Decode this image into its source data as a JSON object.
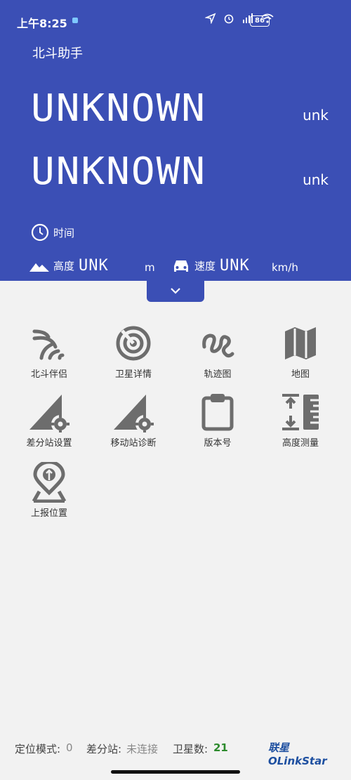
{
  "status": {
    "time": "上午8:25",
    "battery": "86"
  },
  "app_title": "北斗助手",
  "lat": {
    "value": "UNKNOWN",
    "unit": "unk"
  },
  "lon": {
    "value": "UNKNOWN",
    "unit": "unk"
  },
  "time_label": "时间",
  "altitude": {
    "label": "高度",
    "value": "UNK",
    "unit": "m"
  },
  "speed": {
    "label": "速度",
    "value": "UNK",
    "unit": "km/h"
  },
  "tiles": [
    {
      "label": "北斗伴侣",
      "icon": "signal-waves-icon"
    },
    {
      "label": "卫星详情",
      "icon": "radar-icon"
    },
    {
      "label": "轨迹图",
      "icon": "track-icon"
    },
    {
      "label": "地图",
      "icon": "map-icon"
    },
    {
      "label": "差分站设置",
      "icon": "base-station-settings-icon"
    },
    {
      "label": "移动站诊断",
      "icon": "rover-diagnosis-icon"
    },
    {
      "label": "版本号",
      "icon": "clipboard-icon"
    },
    {
      "label": "高度测量",
      "icon": "height-measure-icon"
    },
    {
      "label": "上报位置",
      "icon": "report-location-icon"
    }
  ],
  "footer": {
    "mode_label": "定位模式:",
    "mode_value": "0",
    "station_label": "差分站:",
    "station_value": "未连接",
    "sat_label": "卫星数:",
    "sat_value": "21",
    "logo": "联星 OLinkStar"
  }
}
